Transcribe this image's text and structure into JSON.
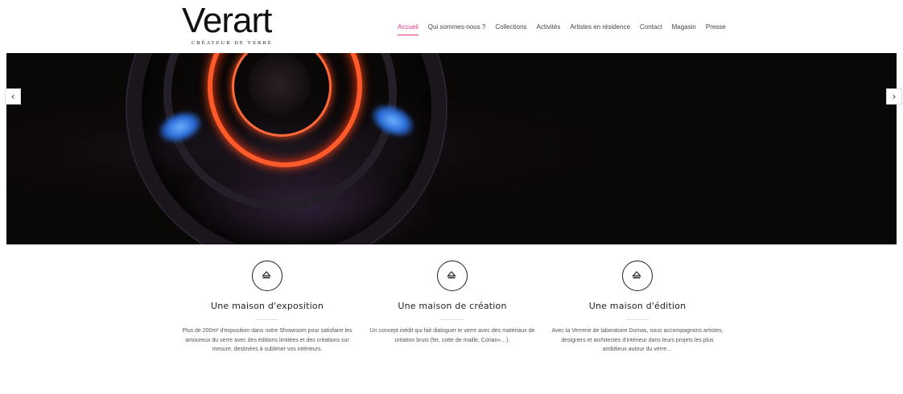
{
  "logo": {
    "word": "Verart",
    "tagline": "CRÉATEUR DE VERRE"
  },
  "nav": {
    "items": [
      {
        "label": "Accueil",
        "active": true
      },
      {
        "label": "Qui sommes-nous ?",
        "active": false
      },
      {
        "label": "Collections",
        "active": false
      },
      {
        "label": "Activités",
        "active": false
      },
      {
        "label": "Artistes en résidence",
        "active": false
      },
      {
        "label": "Contact",
        "active": false
      },
      {
        "label": "Magasin",
        "active": false
      },
      {
        "label": "Presse",
        "active": false
      }
    ]
  },
  "slider": {
    "prev_icon": "chevron-left-icon",
    "next_icon": "chevron-right-icon",
    "prev_glyph": "‹",
    "next_glyph": "›"
  },
  "features": [
    {
      "icon": "eject-icon",
      "title": "Une maison d'exposition",
      "text": "Plus de 200m² d'exposition dans notre Showroom pour satisfaire les amoureux du verre avec des éditions limitées et des créations sur mesure, destinées à sublimer vos intérieurs."
    },
    {
      "icon": "eject-icon",
      "title": "Une maison de création",
      "text": "Un concept inédit qui fait dialoguer le verre avec des matériaux de création bruts (fer, cotte de maille, Corian«…)."
    },
    {
      "icon": "eject-icon",
      "title": "Une maison d'édition",
      "text": "Avec la Verrerie de laboratoire Dumas, nous accompagnons artistes, designers et architectes d'intérieur dans leurs projets les plus ambitieux autour du verre…"
    }
  ],
  "colors": {
    "accent": "#e3338b",
    "hero_bg": "#0c0808",
    "glow": "#ff5a2a",
    "flame": "#2a6bd8"
  }
}
